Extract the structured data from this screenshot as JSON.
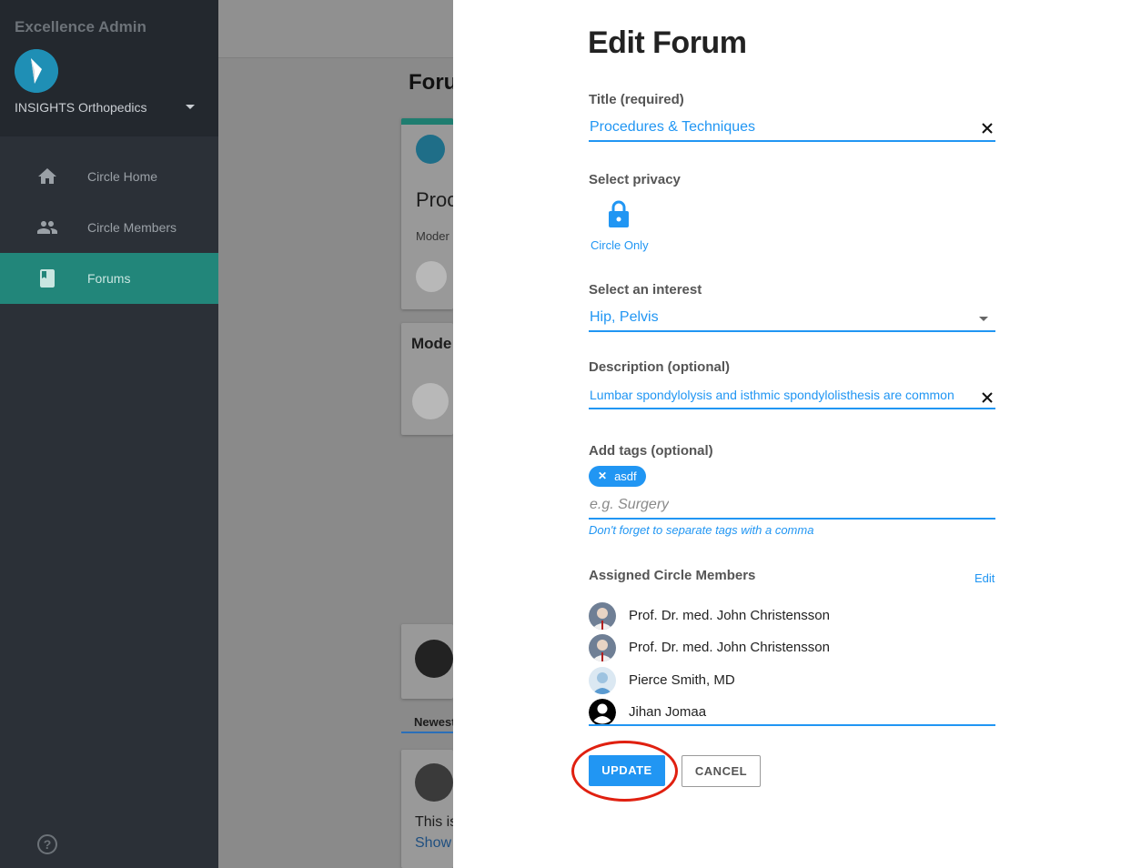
{
  "sidebar": {
    "app_title": "Excellence Admin",
    "org_name": "INSIGHTS Orthopedics",
    "items": [
      {
        "label": "Circle Home",
        "icon": "home-icon",
        "active": false
      },
      {
        "label": "Circle Members",
        "icon": "people-icon",
        "active": false
      },
      {
        "label": "Forums",
        "icon": "book-icon",
        "active": true
      }
    ],
    "help_icon": "?"
  },
  "background": {
    "title": "Foru",
    "card_title": "Proc",
    "card_sub": "Moder",
    "section_title": "Mode",
    "tab_label": "Newest",
    "post_text": "This is",
    "show_link": "Show"
  },
  "drawer": {
    "title": "Edit Forum",
    "title_field": {
      "label": "Title (required)",
      "value": "Procedures & Techniques"
    },
    "privacy": {
      "label": "Select privacy",
      "option_label": "Circle Only",
      "icon": "lock-icon"
    },
    "interest": {
      "label": "Select an interest",
      "value": "Hip, Pelvis"
    },
    "description": {
      "label": "Description (optional)",
      "value": "Lumbar spondylolysis and isthmic spondylolisthesis are common"
    },
    "tags": {
      "label": "Add tags (optional)",
      "chips": [
        "asdf"
      ],
      "placeholder": "e.g. Surgery",
      "hint": "Don't forget to separate tags with a comma"
    },
    "members": {
      "label": "Assigned Circle Members",
      "edit_label": "Edit",
      "list": [
        {
          "name": "Prof. Dr. med. John Christensson"
        },
        {
          "name": "Prof. Dr. med. John Christensson"
        },
        {
          "name": "Pierce Smith, MD"
        },
        {
          "name": "Jihan Jomaa"
        }
      ]
    },
    "update_label": "UPDATE",
    "cancel_label": "CANCEL"
  },
  "colors": {
    "accent": "#2196f3",
    "sidebar_bg": "#2b3037",
    "sidebar_active": "#22867a",
    "highlight": "#e02010"
  }
}
